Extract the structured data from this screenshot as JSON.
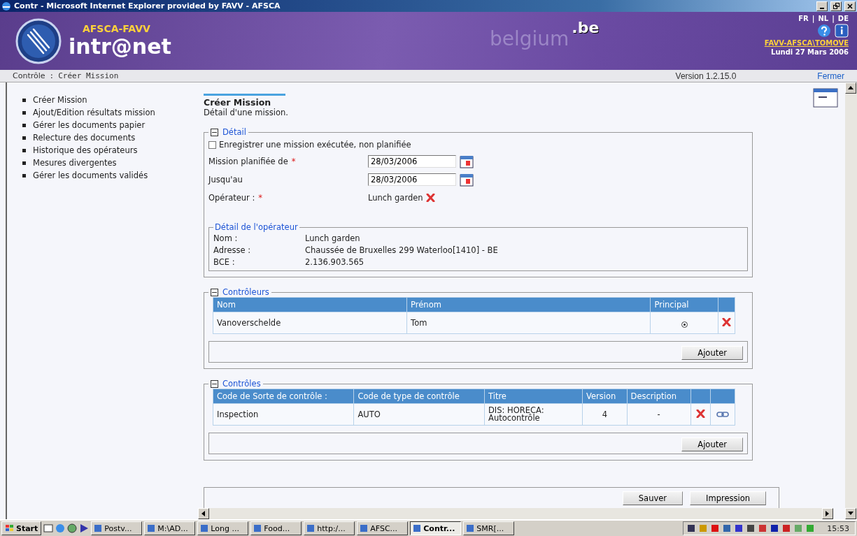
{
  "window": {
    "title": "Contr - Microsoft Internet Explorer provided by FAVV - AFSCA"
  },
  "header": {
    "brand": "AFSCA-FAVV",
    "logo": "intr@net",
    "country": "belgium",
    "domain": ".be",
    "languages": [
      "FR",
      "NL",
      "DE"
    ],
    "separator": "|",
    "user": "FAVV-AFSCA\\TOMOVE",
    "date": "Lundi 27 Mars 2006"
  },
  "breadcrumb": {
    "section": "Contrôle",
    "separator": ":",
    "page": "Créer Mission",
    "version": "Version 1.2.15.0",
    "close": "Fermer"
  },
  "sidebar": {
    "items": [
      "Créer Mission",
      "Ajout/Edition résultats mission",
      "Gérer les documents papier",
      "Relecture des documents",
      "Historique des opérateurs",
      "Mesures divergentes",
      "Gérer les documents validés"
    ]
  },
  "main": {
    "title": "Créer Mission",
    "subtitle": "Détail d'une mission.",
    "detail": {
      "legend": "Détail",
      "expanded": true,
      "checkbox": {
        "label": "Enregistrer une mission exécutée, non planifiée",
        "checked": false
      },
      "required_mark": "*",
      "fields": [
        {
          "kind": "date",
          "label": "Mission planifiée de",
          "required": true,
          "value": "28/03/2006"
        },
        {
          "kind": "date",
          "label": "Jusqu'au",
          "required": false,
          "value": "28/03/2006"
        },
        {
          "kind": "text",
          "label": "Opérateur :",
          "required": true,
          "value": "Lunch garden"
        }
      ],
      "operator": {
        "legend": "Détail de l'opérateur",
        "rows": [
          {
            "label": "Nom :",
            "value": "Lunch garden"
          },
          {
            "label": "Adresse :",
            "value": "Chaussée de Bruxelles 299 Waterloo[1410] - BE"
          },
          {
            "label": "BCE :",
            "value": "2.136.903.565"
          }
        ]
      }
    },
    "controllers": {
      "legend": "Contrôleurs",
      "expanded": true,
      "columns": [
        "Nom",
        "Prénom",
        "Principal"
      ],
      "rows": [
        {
          "nom": "Vanoverschelde",
          "prenom": "Tom",
          "principal": true
        }
      ],
      "button": "Ajouter"
    },
    "controls": {
      "legend": "Contrôles",
      "expanded": true,
      "columns": [
        "Code de Sorte de contrôle :",
        "Code de type de contrôle",
        "Titre",
        "Version",
        "Description"
      ],
      "rows": [
        {
          "cells": [
            "Inspection",
            "AUTO",
            "DIS: HORECA: Autocontrôle",
            "4",
            "-"
          ]
        }
      ],
      "button": "Ajouter"
    },
    "buttons": [
      "Sauver",
      "Impression"
    ]
  },
  "taskbar": {
    "start": "Start",
    "tasks": [
      {
        "label": "Postv...",
        "selected": false
      },
      {
        "label": "M:\\AD...",
        "selected": false
      },
      {
        "label": "Long ...",
        "selected": false
      },
      {
        "label": "Food...",
        "selected": false
      },
      {
        "label": "http:/...",
        "selected": false
      },
      {
        "label": "AFSC...",
        "selected": false
      },
      {
        "label": "Contr...",
        "selected": true
      },
      {
        "label": "SMR[...",
        "selected": false
      }
    ],
    "clock": "15:53"
  }
}
